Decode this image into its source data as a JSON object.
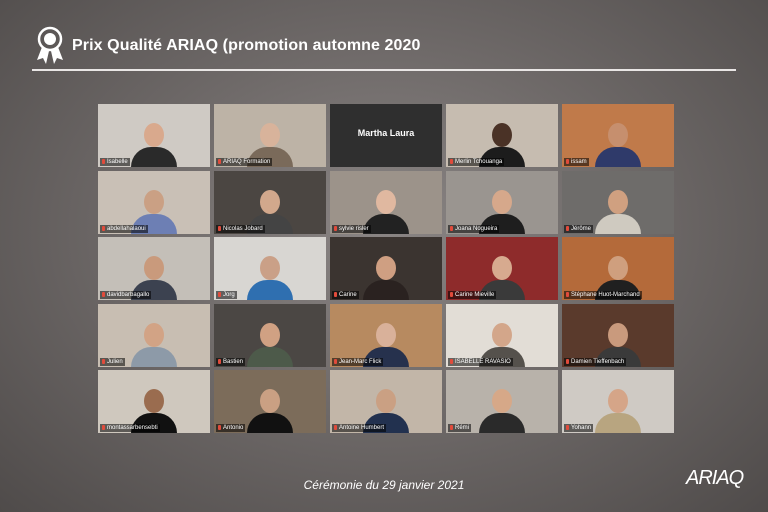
{
  "header": {
    "title": "Prix Qualité ARIAQ (promotion automne 2020",
    "icon": "award-ribbon-icon"
  },
  "participants": [
    {
      "name": "Isabelle",
      "bg": "#cfcac4",
      "skin": "#d9a98d",
      "shirt": "#2a2a2a"
    },
    {
      "name": "ARIAQ Formation",
      "bg": "#bdb3a6",
      "skin": "#d8b39b",
      "shirt": "#7a6a5a"
    },
    {
      "name": "Martha Laura",
      "bg": "#2f2f2f",
      "skin": "",
      "shirt": "",
      "video_off": true
    },
    {
      "name": "Merlin Tchouanga",
      "bg": "#c6bcb0",
      "skin": "#4a3226",
      "shirt": "#1c1c1c"
    },
    {
      "name": "issam",
      "bg": "#c07a4a",
      "skin": "#c68f6e",
      "shirt": "#2f3a6a"
    },
    {
      "name": "abdellahalaoui",
      "bg": "#c9c0b6",
      "skin": "#caa084",
      "shirt": "#6d7fb4"
    },
    {
      "name": "Nicolas Jobard",
      "bg": "#4b4642",
      "skin": "#d2a88c",
      "shirt": "#444"
    },
    {
      "name": "sylvie risler",
      "bg": "#9c938a",
      "skin": "#e0b8a0",
      "shirt": "#222"
    },
    {
      "name": "Joana Nogueira",
      "bg": "#9a9590",
      "skin": "#d6a88b",
      "shirt": "#1e1e1e"
    },
    {
      "name": "Jérôme",
      "bg": "#6e6c6a",
      "skin": "#d0a080",
      "shirt": "#cfcac0"
    },
    {
      "name": "davidbarbagallo",
      "bg": "#c4bfb8",
      "skin": "#c99a7c",
      "shirt": "#3c4250"
    },
    {
      "name": "Jorg",
      "bg": "#d8d6d2",
      "skin": "#caa087",
      "shirt": "#2f6fb0"
    },
    {
      "name": "Carine",
      "bg": "#3b3430",
      "skin": "#cf9f82",
      "shirt": "#2a2220"
    },
    {
      "name": "Carine Mieville",
      "bg": "#8e2b2b",
      "skin": "#d7aa8f",
      "shirt": "#3a3a3a",
      "active": true
    },
    {
      "name": "Stéphane Huot-Marchand",
      "bg": "#b46a3a",
      "skin": "#cf9f7e",
      "shirt": "#202020"
    },
    {
      "name": "Julien",
      "bg": "#c8beb2",
      "skin": "#d2a385",
      "shirt": "#8d9aa8"
    },
    {
      "name": "Bastien",
      "bg": "#4b4744",
      "skin": "#d0a183",
      "shirt": "#4d5a4a"
    },
    {
      "name": "Jean-Marc Flick",
      "bg": "#b78a60",
      "skin": "#d9b19a",
      "shirt": "#26314d"
    },
    {
      "name": "ISABELLE RAVASIO",
      "bg": "#e2ddd6",
      "skin": "#d3a68a",
      "shirt": "#55514c"
    },
    {
      "name": "Damien Tieffenbach",
      "bg": "#5a3a2c",
      "skin": "#c99a7d",
      "shirt": "#3a3a3a"
    },
    {
      "name": "montassarbensebti",
      "bg": "#cfc8be",
      "skin": "#9a6c4f",
      "shirt": "#111"
    },
    {
      "name": "Antonio",
      "bg": "#7c6c5a",
      "skin": "#caa083",
      "shirt": "#111"
    },
    {
      "name": "Antoine Humbert",
      "bg": "#c2b6a8",
      "skin": "#caa083",
      "shirt": "#22314f"
    },
    {
      "name": "Rémi",
      "bg": "#b8b2aa",
      "skin": "#d6a888",
      "shirt": "#2a2a2a"
    },
    {
      "name": "Yohann",
      "bg": "#cfcac4",
      "skin": "#d5a588",
      "shirt": "#b8a580"
    }
  ],
  "footer": {
    "ceremony": "Cérémonie du 29 janvier 2021",
    "logo": "ARIAQ"
  },
  "colors": {
    "active_border": "#d8d24a",
    "muted_mic": "#e14b3b"
  }
}
